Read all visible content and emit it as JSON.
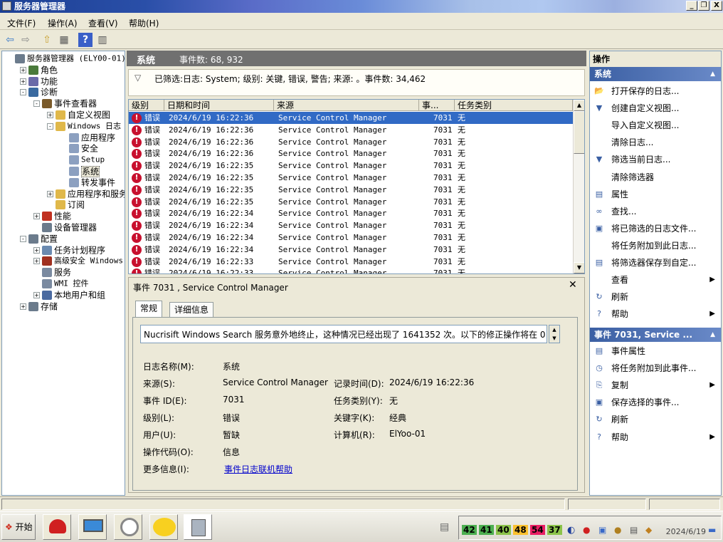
{
  "window": {
    "title": "服务器管理器",
    "buttons": {
      "minimize": "_",
      "restore": "❐",
      "close": "X"
    }
  },
  "menubar": [
    "文件(F)",
    "操作(A)",
    "查看(V)",
    "帮助(H)"
  ],
  "tree": [
    {
      "label": "服务器管理器 (ELY00-01)",
      "indent": 0,
      "exp": "",
      "icon": "server-icon",
      "color": "#6b7b8c"
    },
    {
      "label": "角色",
      "indent": 1,
      "exp": "+",
      "icon": "roles-icon",
      "color": "#4a7a3a"
    },
    {
      "label": "功能",
      "indent": 1,
      "exp": "+",
      "icon": "features-icon",
      "color": "#6a6aa8"
    },
    {
      "label": "诊断",
      "indent": 1,
      "exp": "-",
      "icon": "diagnostics-icon",
      "color": "#3a6aa0"
    },
    {
      "label": "事件查看器",
      "indent": 2,
      "exp": "-",
      "icon": "event-viewer-icon",
      "color": "#7a5a2a"
    },
    {
      "label": "自定义视图",
      "indent": 3,
      "exp": "+",
      "icon": "folder-icon",
      "color": "#e0b84a"
    },
    {
      "label": "Windows 日志",
      "indent": 3,
      "exp": "-",
      "icon": "folder-icon",
      "color": "#e0b84a"
    },
    {
      "label": "应用程序",
      "indent": 4,
      "exp": "",
      "icon": "log-icon",
      "color": "#8ca0c0"
    },
    {
      "label": "安全",
      "indent": 4,
      "exp": "",
      "icon": "log-icon",
      "color": "#8ca0c0"
    },
    {
      "label": "Setup",
      "indent": 4,
      "exp": "",
      "icon": "log-icon",
      "color": "#8ca0c0"
    },
    {
      "label": "系统",
      "indent": 4,
      "exp": "",
      "icon": "log-icon",
      "color": "#8ca0c0",
      "selected": true
    },
    {
      "label": "转发事件",
      "indent": 4,
      "exp": "",
      "icon": "log-icon",
      "color": "#8ca0c0"
    },
    {
      "label": "应用程序和服务日",
      "indent": 3,
      "exp": "+",
      "icon": "folder-icon",
      "color": "#e0b84a"
    },
    {
      "label": "订阅",
      "indent": 3,
      "exp": "",
      "icon": "subscription-icon",
      "color": "#e0b84a"
    },
    {
      "label": "性能",
      "indent": 2,
      "exp": "+",
      "icon": "performance-icon",
      "color": "#c03020"
    },
    {
      "label": "设备管理器",
      "indent": 2,
      "exp": "",
      "icon": "device-manager-icon",
      "color": "#6b7b8c"
    },
    {
      "label": "配置",
      "indent": 1,
      "exp": "-",
      "icon": "configuration-icon",
      "color": "#6b7b8c"
    },
    {
      "label": "任务计划程序",
      "indent": 2,
      "exp": "+",
      "icon": "clock-icon",
      "color": "#6b8ab0"
    },
    {
      "label": "高级安全 Windows 防",
      "indent": 2,
      "exp": "+",
      "icon": "firewall-icon",
      "color": "#a03020"
    },
    {
      "label": "服务",
      "indent": 2,
      "exp": "",
      "icon": "services-icon",
      "color": "#7a8aa0"
    },
    {
      "label": "WMI 控件",
      "indent": 2,
      "exp": "",
      "icon": "wmi-icon",
      "color": "#7a8aa0"
    },
    {
      "label": "本地用户和组",
      "indent": 2,
      "exp": "+",
      "icon": "users-icon",
      "color": "#4a6aa0"
    },
    {
      "label": "存储",
      "indent": 1,
      "exp": "+",
      "icon": "storage-icon",
      "color": "#6b7b8c"
    }
  ],
  "center": {
    "title": "系统",
    "event_count_label": "事件数: 68, 932",
    "filter_text": "已筛选:日志: System; 级别: 关键, 错误, 警告; 来源: 。事件数: 34,462",
    "columns": [
      "级别",
      "日期和时间",
      "来源",
      "事...",
      "任务类别"
    ],
    "rows": [
      {
        "level": "错误",
        "time": "2024/6/19 16:22:36",
        "source": "Service Control Manager",
        "id": "7031",
        "task": "无"
      },
      {
        "level": "错误",
        "time": "2024/6/19 16:22:36",
        "source": "Service Control Manager",
        "id": "7031",
        "task": "无"
      },
      {
        "level": "错误",
        "time": "2024/6/19 16:22:36",
        "source": "Service Control Manager",
        "id": "7031",
        "task": "无"
      },
      {
        "level": "错误",
        "time": "2024/6/19 16:22:36",
        "source": "Service Control Manager",
        "id": "7031",
        "task": "无"
      },
      {
        "level": "错误",
        "time": "2024/6/19 16:22:35",
        "source": "Service Control Manager",
        "id": "7031",
        "task": "无"
      },
      {
        "level": "错误",
        "time": "2024/6/19 16:22:35",
        "source": "Service Control Manager",
        "id": "7031",
        "task": "无"
      },
      {
        "level": "错误",
        "time": "2024/6/19 16:22:35",
        "source": "Service Control Manager",
        "id": "7031",
        "task": "无"
      },
      {
        "level": "错误",
        "time": "2024/6/19 16:22:35",
        "source": "Service Control Manager",
        "id": "7031",
        "task": "无"
      },
      {
        "level": "错误",
        "time": "2024/6/19 16:22:34",
        "source": "Service Control Manager",
        "id": "7031",
        "task": "无"
      },
      {
        "level": "错误",
        "time": "2024/6/19 16:22:34",
        "source": "Service Control Manager",
        "id": "7031",
        "task": "无"
      },
      {
        "level": "错误",
        "time": "2024/6/19 16:22:34",
        "source": "Service Control Manager",
        "id": "7031",
        "task": "无"
      },
      {
        "level": "错误",
        "time": "2024/6/19 16:22:34",
        "source": "Service Control Manager",
        "id": "7031",
        "task": "无"
      },
      {
        "level": "错误",
        "time": "2024/6/19 16:22:33",
        "source": "Service Control Manager",
        "id": "7031",
        "task": "无"
      },
      {
        "level": "错误",
        "time": "2024/6/19 16:22:33",
        "source": "Service Control Manager",
        "id": "7031",
        "task": "无"
      }
    ]
  },
  "detail": {
    "title": "事件 7031 , Service Control Manager",
    "tabs": [
      "常规",
      "详细信息"
    ],
    "description": "Nucrisift Windows Search 服务意外地终止，这种情况已经出现了 1641352 次。以下的修正操作将在 0",
    "fields": {
      "log_name_label": "日志名称(M):",
      "log_name": "系统",
      "source_label": "来源(S):",
      "source": "Service Control Manager",
      "logged_label": "记录时间(D):",
      "logged": "2024/6/19 16:22:36",
      "event_id_label": "事件 ID(E):",
      "event_id": "7031",
      "task_label": "任务类别(Y):",
      "task": "无",
      "level_label": "级别(L):",
      "level": "错误",
      "keywords_label": "关键字(K):",
      "keywords": "经典",
      "user_label": "用户(U):",
      "user": "暂缺",
      "computer_label": "计算机(R):",
      "computer": "ElYoo-01",
      "opcode_label": "操作代码(O):",
      "opcode": "信息",
      "more_info_label": "更多信息(I):",
      "more_info_link": "事件日志联机帮助"
    }
  },
  "actions": {
    "title": "操作",
    "section1": "系统",
    "items1": [
      {
        "label": "打开保存的日志...",
        "icon": "open-folder-icon",
        "glyph": "📂",
        "arrow": false
      },
      {
        "label": "创建自定义视图...",
        "icon": "filter-icon",
        "glyph": "▼",
        "arrow": false
      },
      {
        "label": "导入自定义视图...",
        "icon": "",
        "glyph": "",
        "arrow": false
      },
      {
        "label": "清除日志...",
        "icon": "",
        "glyph": "",
        "arrow": false
      },
      {
        "label": "筛选当前日志...",
        "icon": "filter-icon",
        "glyph": "▼",
        "arrow": false
      },
      {
        "label": "清除筛选器",
        "icon": "",
        "glyph": "",
        "arrow": false
      },
      {
        "label": "属性",
        "icon": "properties-icon",
        "glyph": "▤",
        "arrow": false
      },
      {
        "label": "查找...",
        "icon": "binoculars-icon",
        "glyph": "∞",
        "arrow": false
      },
      {
        "label": "将已筛选的日志文件...",
        "icon": "save-icon",
        "glyph": "▣",
        "arrow": false
      },
      {
        "label": "将任务附加到此日志...",
        "icon": "",
        "glyph": "",
        "arrow": false
      },
      {
        "label": "将筛选器保存到自定...",
        "icon": "filter-save-icon",
        "glyph": "▤",
        "arrow": false
      },
      {
        "label": "查看",
        "icon": "",
        "glyph": "",
        "arrow": true
      },
      {
        "label": "刷新",
        "icon": "refresh-icon",
        "glyph": "↻",
        "arrow": false
      },
      {
        "label": "帮助",
        "icon": "help-icon",
        "glyph": "?",
        "arrow": true
      }
    ],
    "section2": "事件 7031, Service ...",
    "items2": [
      {
        "label": "事件属性",
        "icon": "properties-icon",
        "glyph": "▤",
        "arrow": false
      },
      {
        "label": "将任务附加到此事件...",
        "icon": "task-icon",
        "glyph": "◷",
        "arrow": false
      },
      {
        "label": "复制",
        "icon": "copy-icon",
        "glyph": "⎘",
        "arrow": true
      },
      {
        "label": "保存选择的事件...",
        "icon": "save-icon",
        "glyph": "▣",
        "arrow": false
      },
      {
        "label": "刷新",
        "icon": "refresh-icon",
        "glyph": "↻",
        "arrow": false
      },
      {
        "label": "帮助",
        "icon": "help-icon",
        "glyph": "?",
        "arrow": true
      }
    ]
  },
  "taskbar": {
    "start_label": "开始",
    "tray_numbers": [
      {
        "value": "42",
        "color": "#4caf50"
      },
      {
        "value": "41",
        "color": "#4caf50"
      },
      {
        "value": "40",
        "color": "#8bc34a"
      },
      {
        "value": "48",
        "color": "#fbc02d"
      },
      {
        "value": "54",
        "color": "#e91e63"
      },
      {
        "value": "37",
        "color": "#8bc34a"
      }
    ],
    "clock": "2024/6/19"
  }
}
